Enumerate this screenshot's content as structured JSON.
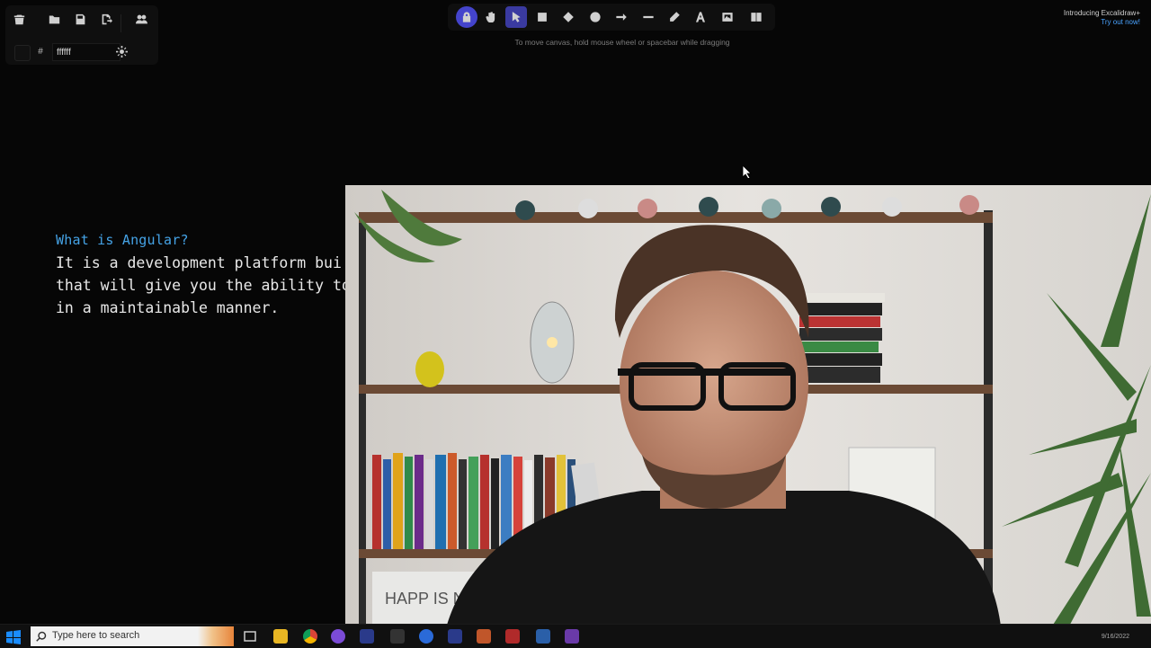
{
  "app": {
    "background_hex": "ffffff",
    "hash_label": "#"
  },
  "top_left_icons": [
    "trash-icon",
    "open-folder-icon",
    "save-icon",
    "export-icon",
    "collaborate-icon",
    "settings-icon"
  ],
  "toolbar": {
    "tools": [
      "lock",
      "hand",
      "selection",
      "rectangle",
      "diamond",
      "ellipse",
      "arrow",
      "line",
      "draw",
      "text",
      "image",
      "library"
    ],
    "hint": "To move canvas, hold mouse wheel or spacebar while dragging"
  },
  "promo": {
    "title": "Introducing Excalidraw+",
    "link": "Try out now!"
  },
  "canvas": {
    "heading": "What is Angular?",
    "lines": [
      "It is a development platform bui",
      "that will give you the ability to",
      "in a maintainable manner."
    ]
  },
  "video": {
    "poster_text": "HAPP IS N"
  },
  "taskbar": {
    "search_placeholder": "Type here to search",
    "date": "9/16/2022"
  },
  "colors": {
    "accent": "#4444cc",
    "heading": "#45a3e6",
    "link": "#4aa3ff"
  }
}
